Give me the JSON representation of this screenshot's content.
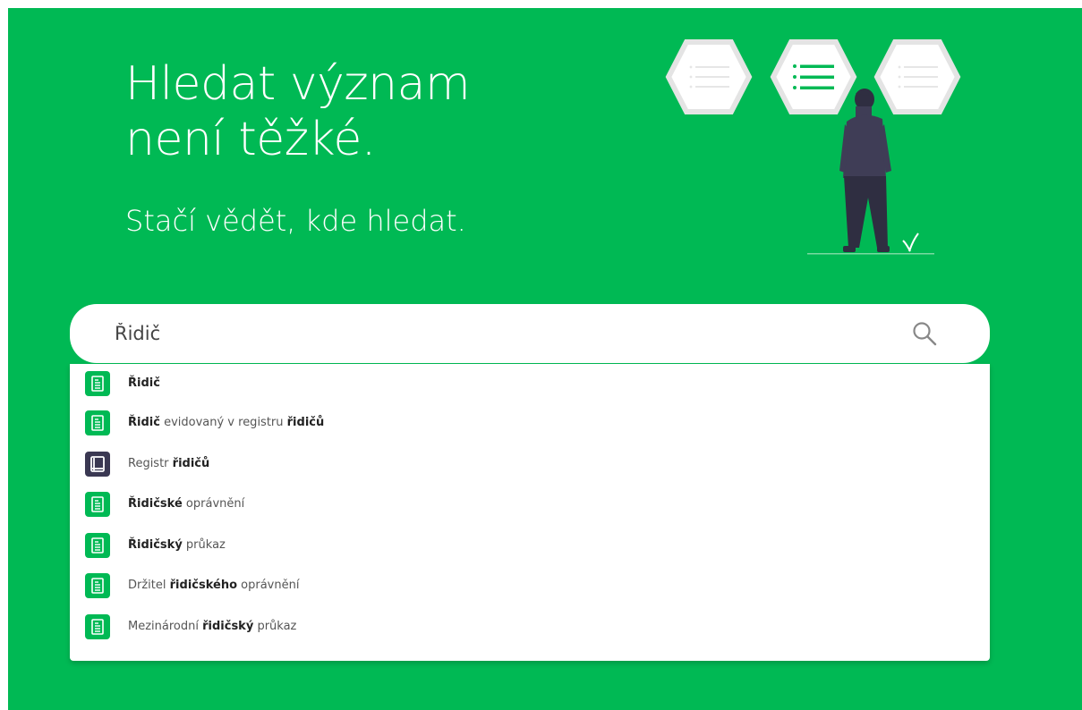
{
  "hero": {
    "title": "Hledat význam\nnení těžké.",
    "subtitle": "Stačí vědět, kde hledat."
  },
  "search": {
    "value": "Řidič",
    "placeholder": ""
  },
  "suggestions": [
    {
      "type": "document-icon",
      "parts": [
        {
          "t": "Řidič",
          "b": true
        }
      ]
    },
    {
      "type": "document-icon",
      "parts": [
        {
          "t": "Řidič",
          "b": true
        },
        {
          "t": " evidovaný v registru ",
          "b": false
        },
        {
          "t": "řidičů",
          "b": true
        }
      ]
    },
    {
      "type": "book-icon",
      "parts": [
        {
          "t": "Registr ",
          "b": false
        },
        {
          "t": "řidičů",
          "b": true
        }
      ]
    },
    {
      "type": "document-icon",
      "parts": [
        {
          "t": "Řidičské",
          "b": true
        },
        {
          "t": " oprávnění",
          "b": false
        }
      ]
    },
    {
      "type": "document-icon",
      "parts": [
        {
          "t": "Řidičský",
          "b": true
        },
        {
          "t": " průkaz",
          "b": false
        }
      ]
    },
    {
      "type": "document-icon",
      "parts": [
        {
          "t": "Držitel ",
          "b": false
        },
        {
          "t": "řidičského",
          "b": true
        },
        {
          "t": " oprávnění",
          "b": false
        }
      ]
    },
    {
      "type": "document-icon",
      "parts": [
        {
          "t": "Mezinárodní ",
          "b": false
        },
        {
          "t": "řidičský",
          "b": true
        },
        {
          "t": " průkaz",
          "b": false
        }
      ]
    }
  ],
  "colors": {
    "brand": "#00b954",
    "book_icon": "#3a3852",
    "figure_body": "#2f2e41"
  },
  "illustration": {
    "icons": [
      "list-hexagon-icon",
      "list-hexagon-active-icon",
      "list-hexagon-icon"
    ]
  }
}
